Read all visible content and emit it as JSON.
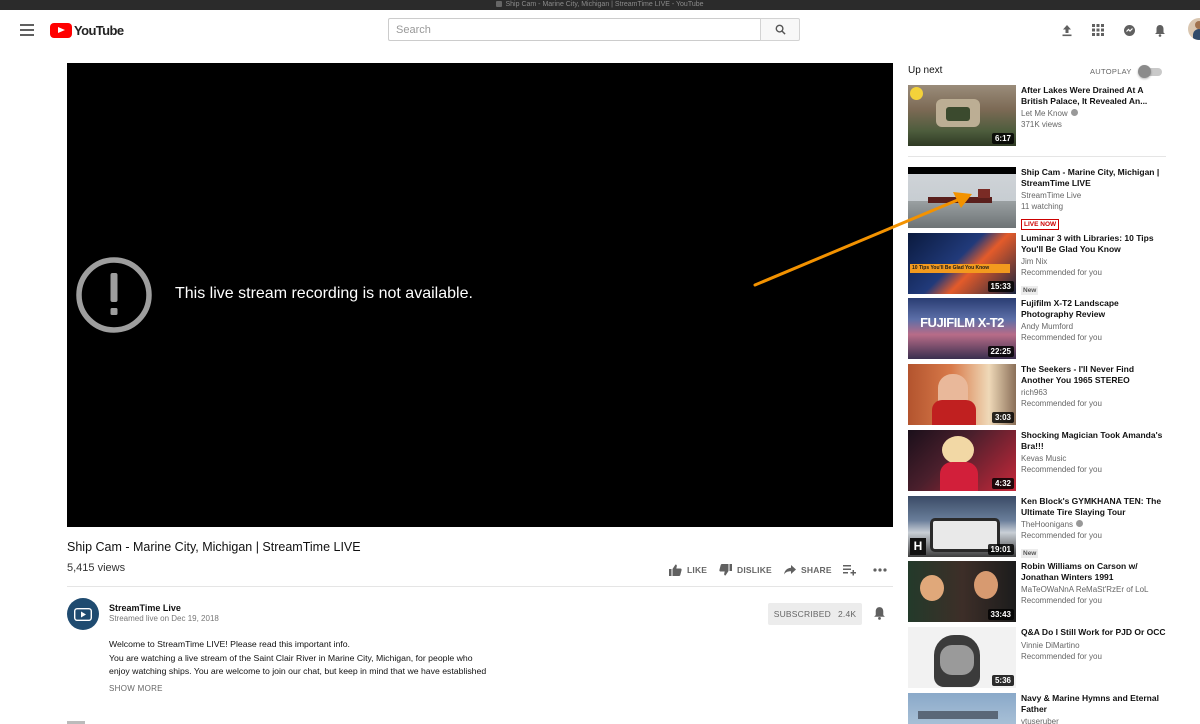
{
  "browser": {
    "tab_title": "Ship Cam - Marine City, Michigan | StreamTime LIVE - YouTube"
  },
  "masthead": {
    "logo_text": "YouTube",
    "search_placeholder": "Search"
  },
  "player": {
    "error_message": "This live stream recording is not available."
  },
  "video": {
    "title": "Ship Cam - Marine City, Michigan | StreamTime LIVE",
    "views": "5,415 views",
    "like_label": "LIKE",
    "dislike_label": "DISLIKE",
    "share_label": "SHARE"
  },
  "channel": {
    "name": "StreamTime Live",
    "streamed_date": "Streamed live on Dec 19, 2018",
    "subscribed_label": "SUBSCRIBED",
    "subscriber_count": "2.4K"
  },
  "description": {
    "line1": "Welcome to StreamTime LIVE! Please read this important info.",
    "line2": "You are watching a live stream of the Saint Clair River in Marine City, Michigan, for people who",
    "line3": "enjoy watching ships. You are welcome to join our chat, but keep in mind that we have established",
    "show_more": "SHOW MORE"
  },
  "sidebar": {
    "up_next": "Up next",
    "autoplay_label": "AUTOPLAY",
    "autoplay_on": false,
    "items": [
      {
        "title": "After Lakes Were Drained At A British Palace, It Revealed An...",
        "channel": "Let Me Know",
        "verified": true,
        "sub": "371K views",
        "duration": "6:17",
        "badge": ""
      },
      {
        "title": "Ship Cam - Marine City, Michigan | StreamTime LIVE",
        "channel": "StreamTime Live",
        "verified": false,
        "sub": "11 watching",
        "duration": "",
        "badge": "LIVE NOW"
      },
      {
        "title": "Luminar 3 with Libraries: 10 Tips You'll Be Glad You Know",
        "channel": "Jim Nix",
        "verified": false,
        "sub": "Recommended for you",
        "duration": "15:33",
        "badge": "New",
        "thumb_text": "10 Tips You'll Be Glad You Know"
      },
      {
        "title": "Fujifilm X-T2 Landscape Photography Review",
        "channel": "Andy Mumford",
        "verified": false,
        "sub": "Recommended for you",
        "duration": "22:25",
        "badge": "",
        "thumb_text": "FUJIFILM X-T2"
      },
      {
        "title": "The Seekers - I'll Never Find Another You 1965 STEREO",
        "channel": "rich963",
        "verified": false,
        "sub": "Recommended for you",
        "duration": "3:03",
        "badge": ""
      },
      {
        "title": "Shocking Magician Took Amanda's Bra!!!",
        "channel": "Kevas Music",
        "verified": false,
        "sub": "Recommended for you",
        "duration": "4:32",
        "badge": ""
      },
      {
        "title": "Ken Block's GYMKHANA TEN: The Ultimate Tire Slaying Tour",
        "channel": "TheHoonigans",
        "verified": true,
        "sub": "Recommended for you",
        "duration": "19:01",
        "badge": "New",
        "thumb_text": "H"
      },
      {
        "title": "Robin Williams on Carson w/ Jonathan Winters 1991",
        "channel": "MaTeOWaNnA ReMaSt'RzEr of LoL",
        "verified": false,
        "sub": "Recommended for you",
        "duration": "33:43",
        "badge": ""
      },
      {
        "title": "Q&A Do I Still Work for PJD Or OCC",
        "channel": "Vinnie DiMartino",
        "verified": false,
        "sub": "Recommended for you",
        "duration": "5:36",
        "badge": ""
      },
      {
        "title": "Navy & Marine Hymns and Eternal Father",
        "channel": "vtuseruber",
        "verified": false,
        "sub": "",
        "duration": "",
        "badge": ""
      }
    ]
  },
  "colors": {
    "brand": "#ff0000",
    "live_badge": "#cc0000",
    "annotation_arrow": "#f39200"
  },
  "icons": [
    "menu-icon",
    "search-icon",
    "upload-icon",
    "apps-icon",
    "messages-icon",
    "bell-icon",
    "error-icon",
    "thumbs-up-icon",
    "thumbs-down-icon",
    "share-icon",
    "add-to-playlist-icon",
    "more-icon"
  ]
}
